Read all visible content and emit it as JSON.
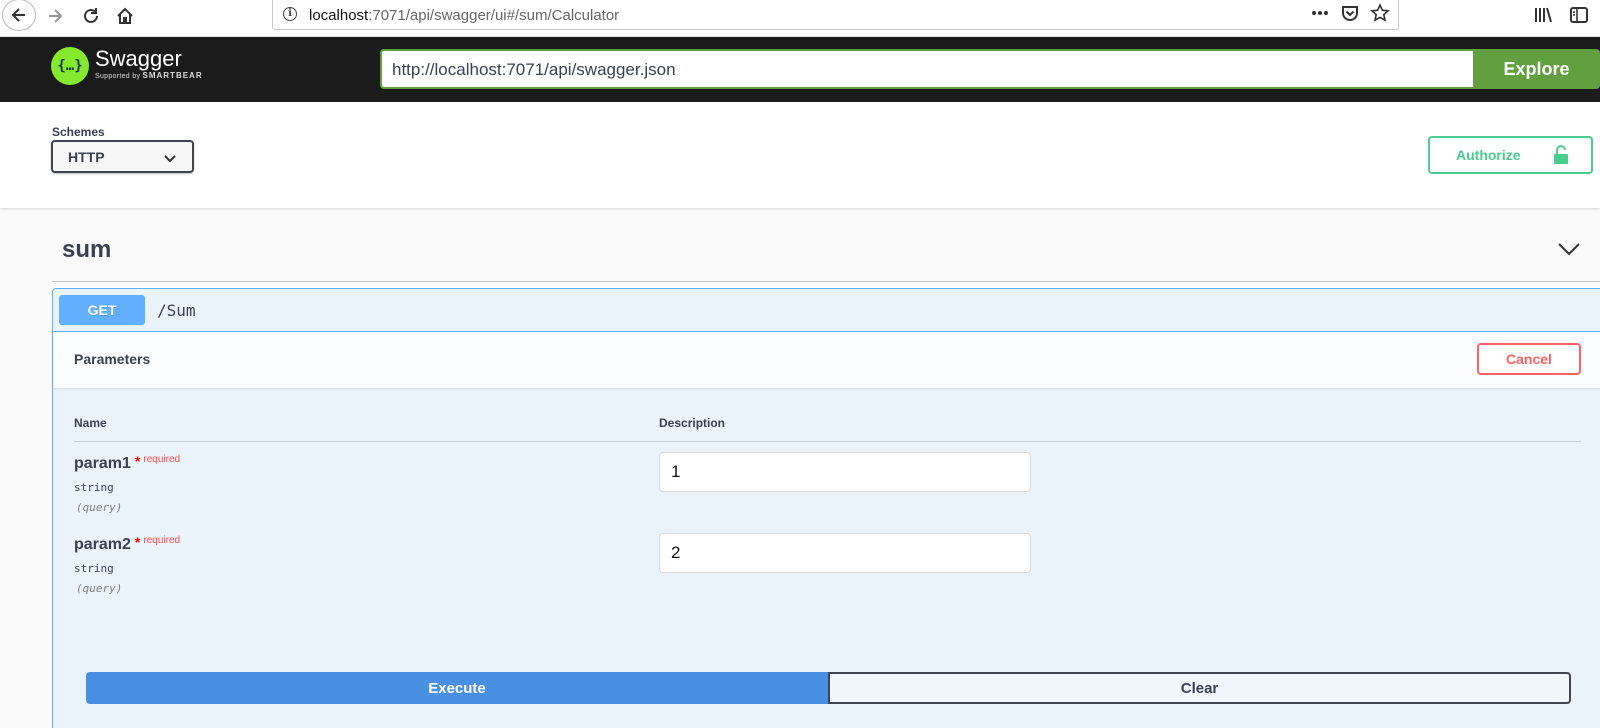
{
  "browser": {
    "url_host": "localhost",
    "url_rest": ":7071/api/swagger/ui#/sum/Calculator"
  },
  "topbar": {
    "logo_title": "Swagger",
    "logo_sub_prefix": "Supported by",
    "logo_sub_brand": "SMARTBEAR",
    "spec_url": "http://localhost:7071/api/swagger.json",
    "explore_label": "Explore"
  },
  "scheme": {
    "label": "Schemes",
    "selected": "HTTP",
    "authorize_label": "Authorize"
  },
  "tag": {
    "title": "sum"
  },
  "operation": {
    "method": "GET",
    "path": "/Sum",
    "params_title": "Parameters",
    "cancel_label": "Cancel",
    "col_name": "Name",
    "col_description": "Description",
    "params": [
      {
        "name": "param1",
        "star": "*",
        "required": "required",
        "type": "string",
        "in": "(query)",
        "value": "1"
      },
      {
        "name": "param2",
        "star": "*",
        "required": "required",
        "type": "string",
        "in": "(query)",
        "value": "2"
      }
    ],
    "execute_label": "Execute",
    "clear_label": "Clear"
  },
  "colors": {
    "swagger_green": "#85ea2d",
    "explore_green": "#62a03f",
    "get_blue": "#61affe",
    "execute_blue": "#4990e2",
    "authorize_green": "#49cc90",
    "cancel_red": "#ff6060"
  }
}
